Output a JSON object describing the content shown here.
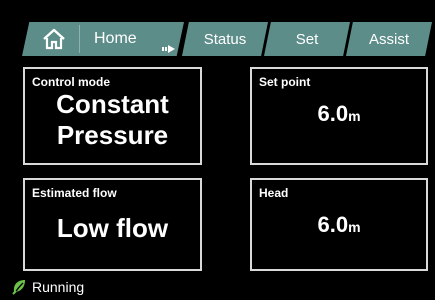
{
  "colors": {
    "tab_bg": "#5c8d89",
    "border": "#d9d9d9",
    "running_icon": "#6cc24a",
    "background": "#000000"
  },
  "tabs": {
    "home": {
      "label": "Home",
      "icon": "home-icon"
    },
    "status": {
      "label": "Status"
    },
    "set": {
      "label": "Set"
    },
    "assist": {
      "label": "Assist"
    }
  },
  "panels": {
    "control_mode": {
      "label": "Control mode",
      "value_line1": "Constant",
      "value_line2": "Pressure"
    },
    "set_point": {
      "label": "Set point",
      "value": "6.0",
      "unit": "m"
    },
    "estimated_flow": {
      "label": "Estimated flow",
      "value": "Low flow"
    },
    "head": {
      "label": "Head",
      "value": "6.0",
      "unit": "m"
    }
  },
  "status": {
    "text": "Running",
    "icon": "running-leaf-icon"
  }
}
